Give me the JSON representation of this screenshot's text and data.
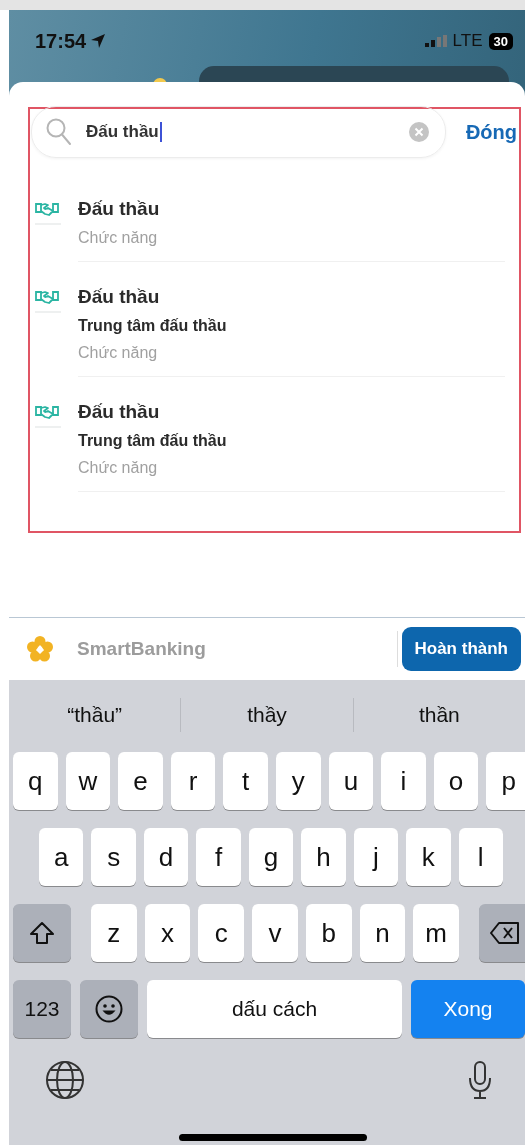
{
  "status_bar": {
    "time": "17:54",
    "network": "LTE",
    "battery": "30"
  },
  "search": {
    "value": "Đấu thầu",
    "close_button": "Đóng"
  },
  "results": [
    {
      "title": "Đấu thầu",
      "category": "Chức năng"
    },
    {
      "title": "Đấu thầu",
      "subtitle": "Trung tâm đấu thầu",
      "category": "Chức năng"
    },
    {
      "title": "Đấu thầu",
      "subtitle": "Trung tâm đấu thầu",
      "category": "Chức năng"
    }
  ],
  "accessory_bar": {
    "brand": "SmartBanking",
    "done_button": "Hoàn thành"
  },
  "keyboard": {
    "suggestions": [
      "“thầu”",
      "thầy",
      "thần"
    ],
    "rows": [
      {
        "keys": [
          {
            "kind": "letter",
            "label": "q"
          },
          {
            "kind": "letter",
            "label": "w"
          },
          {
            "kind": "letter",
            "label": "e"
          },
          {
            "kind": "letter",
            "label": "r"
          },
          {
            "kind": "letter",
            "label": "t"
          },
          {
            "kind": "letter",
            "label": "y"
          },
          {
            "kind": "letter",
            "label": "u"
          },
          {
            "kind": "letter",
            "label": "i"
          },
          {
            "kind": "letter",
            "label": "o"
          },
          {
            "kind": "letter",
            "label": "p"
          }
        ]
      },
      {
        "keys": [
          {
            "kind": "letter",
            "label": "a"
          },
          {
            "kind": "letter",
            "label": "s"
          },
          {
            "kind": "letter",
            "label": "d"
          },
          {
            "kind": "letter",
            "label": "f"
          },
          {
            "kind": "letter",
            "label": "g"
          },
          {
            "kind": "letter",
            "label": "h"
          },
          {
            "kind": "letter",
            "label": "j"
          },
          {
            "kind": "letter",
            "label": "k"
          },
          {
            "kind": "letter",
            "label": "l"
          }
        ]
      },
      {
        "keys": [
          {
            "kind": "shift"
          },
          {
            "kind": "letter",
            "label": "z"
          },
          {
            "kind": "letter",
            "label": "x"
          },
          {
            "kind": "letter",
            "label": "c"
          },
          {
            "kind": "letter",
            "label": "v"
          },
          {
            "kind": "letter",
            "label": "b"
          },
          {
            "kind": "letter",
            "label": "n"
          },
          {
            "kind": "letter",
            "label": "m"
          },
          {
            "kind": "backspace"
          }
        ]
      },
      {
        "keys": [
          {
            "kind": "numbers",
            "label": "123"
          },
          {
            "kind": "emoji"
          },
          {
            "kind": "space",
            "label": "dấu cách"
          },
          {
            "kind": "return",
            "label": "Xong"
          }
        ]
      }
    ]
  }
}
